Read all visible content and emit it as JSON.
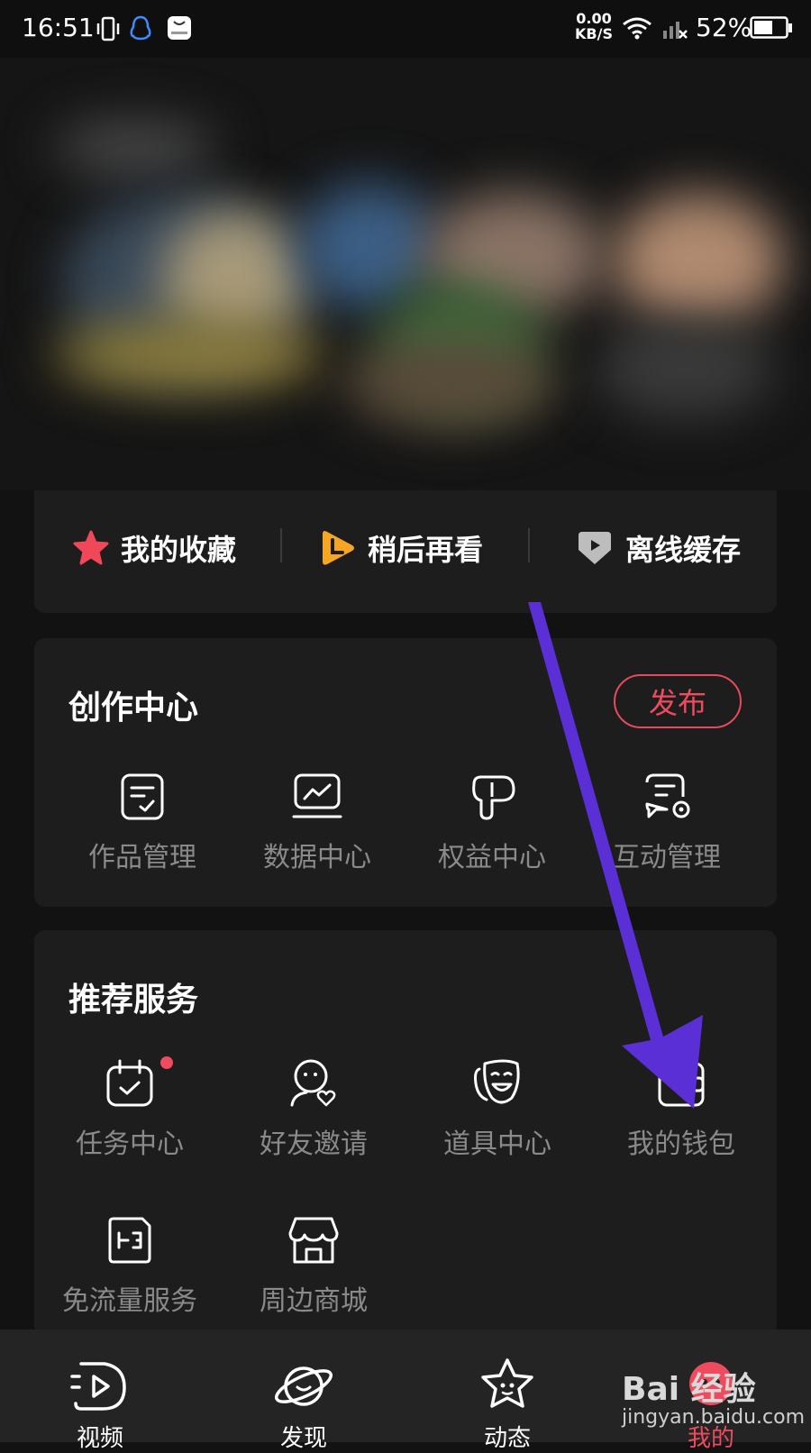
{
  "status_bar": {
    "time": "16:51",
    "speed_value": "0.00",
    "speed_unit": "KB/S",
    "battery": "52%"
  },
  "quick_access": {
    "favorites": "我的收藏",
    "watch_later": "稍后再看",
    "offline": "离线缓存"
  },
  "creator_center": {
    "title": "创作中心",
    "publish": "发布",
    "items": [
      {
        "label": "作品管理",
        "icon": "works-manage-icon"
      },
      {
        "label": "数据中心",
        "icon": "data-chart-icon"
      },
      {
        "label": "权益中心",
        "icon": "rights-icon"
      },
      {
        "label": "互动管理",
        "icon": "interaction-icon"
      }
    ]
  },
  "recommended": {
    "title": "推荐服务",
    "items": [
      {
        "label": "任务中心",
        "icon": "task-calendar-icon",
        "badge": true
      },
      {
        "label": "好友邀请",
        "icon": "invite-friend-icon"
      },
      {
        "label": "道具中心",
        "icon": "props-mask-icon"
      },
      {
        "label": "我的钱包",
        "icon": "wallet-icon"
      },
      {
        "label": "免流量服务",
        "icon": "free-data-icon"
      },
      {
        "label": "周边商城",
        "icon": "store-icon"
      }
    ]
  },
  "bottom_nav": [
    {
      "label": "视频",
      "icon": "video-icon"
    },
    {
      "label": "发现",
      "icon": "planet-icon"
    },
    {
      "label": "动态",
      "icon": "star-face-icon"
    },
    {
      "label": "我的",
      "icon": "profile-icon"
    }
  ],
  "watermark": {
    "logo": "Bai 经验",
    "url": "jingyan.baidu.com"
  },
  "colors": {
    "accent": "#ee4c5e",
    "background": "#121212",
    "card": "#1d1d1d",
    "annotation_arrow": "#5b2fd6"
  }
}
